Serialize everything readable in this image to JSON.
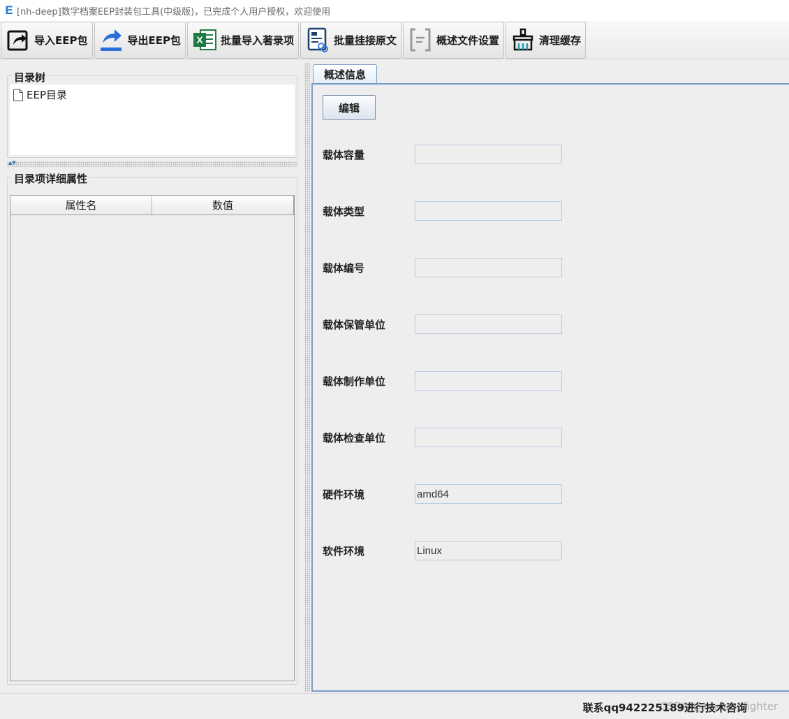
{
  "window": {
    "logo": "E",
    "title": "[nh-deep]数字档案EEP封装包工具(中级版)，已完成个人用户授权，欢迎使用"
  },
  "toolbar": {
    "buttons": [
      {
        "label": "导入EEP包",
        "icon": "import-arrow-icon"
      },
      {
        "label": "导出EEP包",
        "icon": "export-arrow-icon"
      },
      {
        "label": "批量导入著录项",
        "icon": "excel-icon"
      },
      {
        "label": "批量挂接原文",
        "icon": "document-link-icon"
      },
      {
        "label": "概述文件设置",
        "icon": "bracket-doc-icon"
      },
      {
        "label": "清理缓存",
        "icon": "broom-icon"
      }
    ]
  },
  "left": {
    "tree": {
      "title": "目录树",
      "nodes": [
        {
          "label": "EEP目录",
          "icon": "file-icon"
        }
      ]
    },
    "details": {
      "title": "目录项详细属性",
      "columns": [
        "属性名",
        "数值"
      ]
    }
  },
  "right": {
    "tab": "概述信息",
    "edit_label": "编辑",
    "fields": [
      {
        "label": "载体容量",
        "value": ""
      },
      {
        "label": "载体类型",
        "value": ""
      },
      {
        "label": "载体编号",
        "value": ""
      },
      {
        "label": "载体保管单位",
        "value": ""
      },
      {
        "label": "载体制作单位",
        "value": ""
      },
      {
        "label": "载体检查单位",
        "value": ""
      },
      {
        "label": "硬件环境",
        "value": "amd64"
      },
      {
        "label": "软件环境",
        "value": "Linux"
      }
    ]
  },
  "status": {
    "text": "联系qq942225189进行技术咨询",
    "watermark": "CSDN @nhdeepfighter"
  },
  "colors": {
    "accent": "#1e78d2",
    "tab_border": "#7a9cc8",
    "input_border": "#b9cbe1"
  }
}
